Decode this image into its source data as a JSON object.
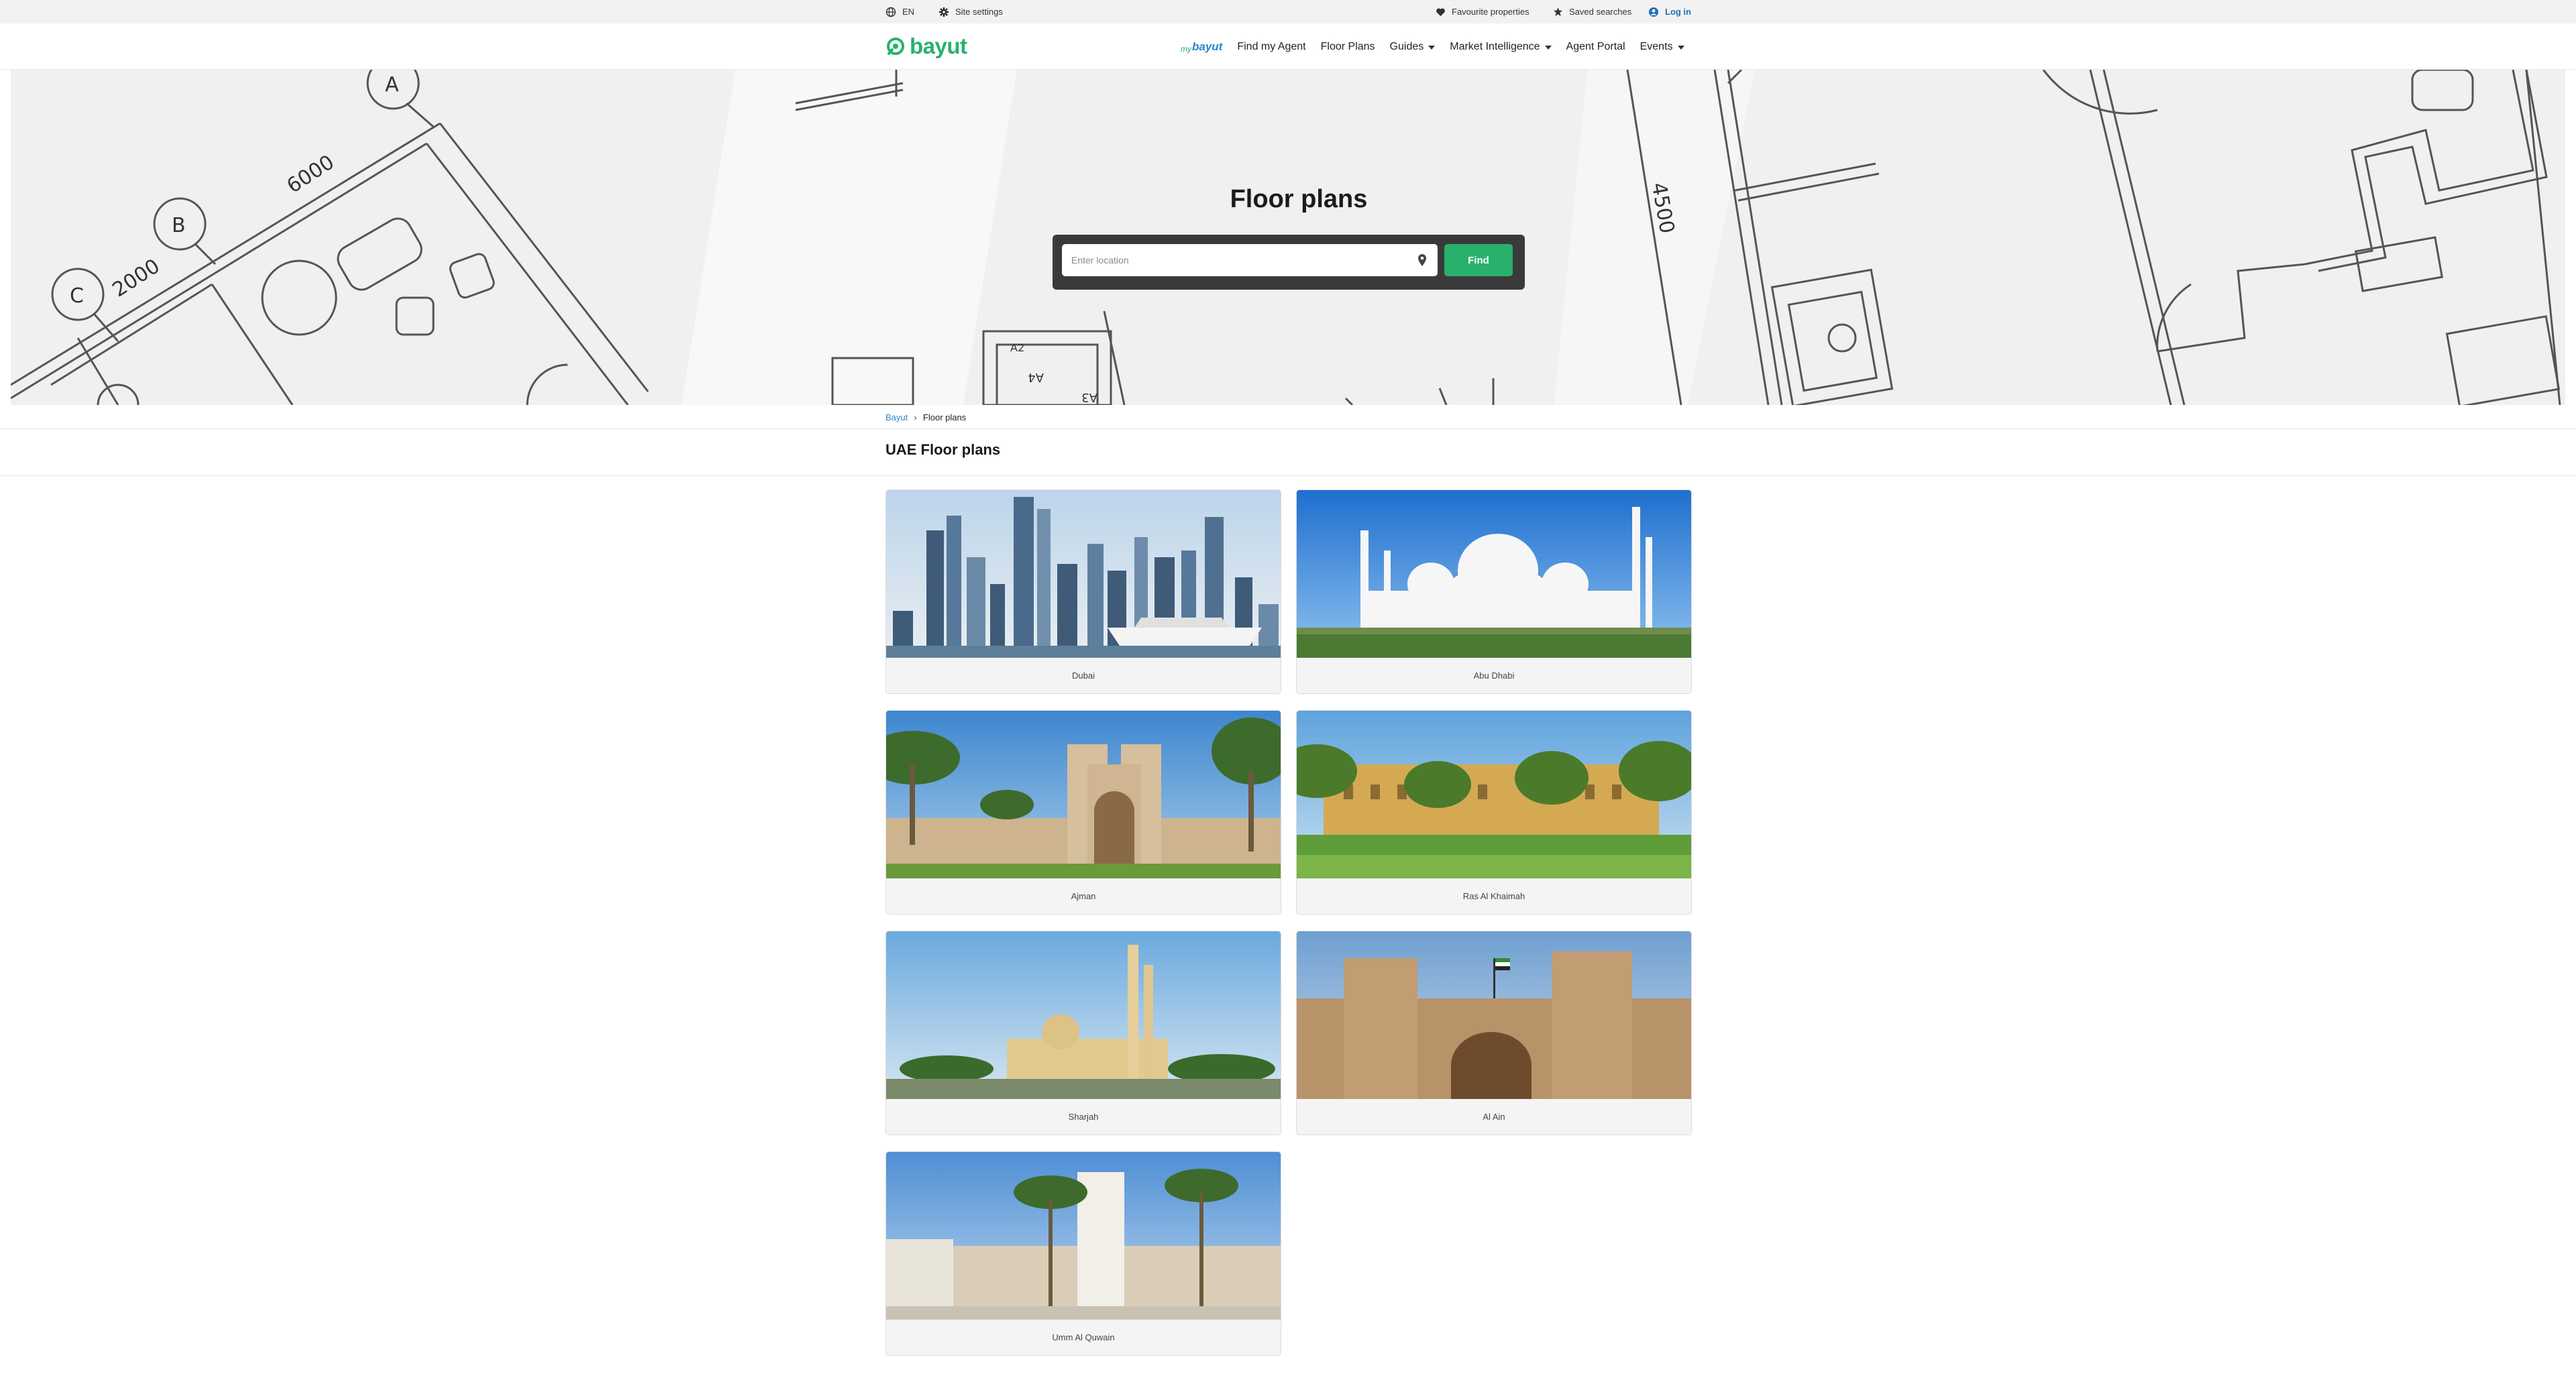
{
  "top_bar": {
    "language": "EN",
    "site_settings": "Site settings",
    "favourites": "Favourite properties",
    "saved_searches": "Saved searches",
    "login": "Log in"
  },
  "brand": {
    "name": "bayut",
    "color": "#28b16d"
  },
  "nav": {
    "mybayut_prefix": "my",
    "mybayut_name": "bayut",
    "items": [
      "Find my Agent",
      "Floor Plans",
      "Guides",
      "Market Intelligence",
      "Agent Portal",
      "Events"
    ]
  },
  "hero": {
    "title": "Floor plans",
    "search_placeholder": "Enter location",
    "find_button": "Find",
    "plan_labels": [
      "A",
      "B",
      "C",
      "6000",
      "2000",
      "4500",
      "A4",
      "A3",
      "A2"
    ]
  },
  "breadcrumb": [
    "Bayut",
    "Floor plans"
  ],
  "section_title": "UAE Floor plans",
  "cities": [
    {
      "name": "Dubai",
      "icon": "dubai-skyline-photo"
    },
    {
      "name": "Abu Dhabi",
      "icon": "grand-mosque-photo"
    },
    {
      "name": "Ajman",
      "icon": "ajman-museum-photo"
    },
    {
      "name": "Ras Al Khaimah",
      "icon": "rak-palm-buildings-photo"
    },
    {
      "name": "Sharjah",
      "icon": "sharjah-mosque-photo"
    },
    {
      "name": "Al Ain",
      "icon": "al-ain-fort-photo"
    },
    {
      "name": "Umm Al Quwain",
      "icon": "uaq-fort-photo"
    }
  ],
  "colors": {
    "accent": "#28b16d",
    "link": "#2a86c8",
    "search_box": "#3a3a3a"
  }
}
